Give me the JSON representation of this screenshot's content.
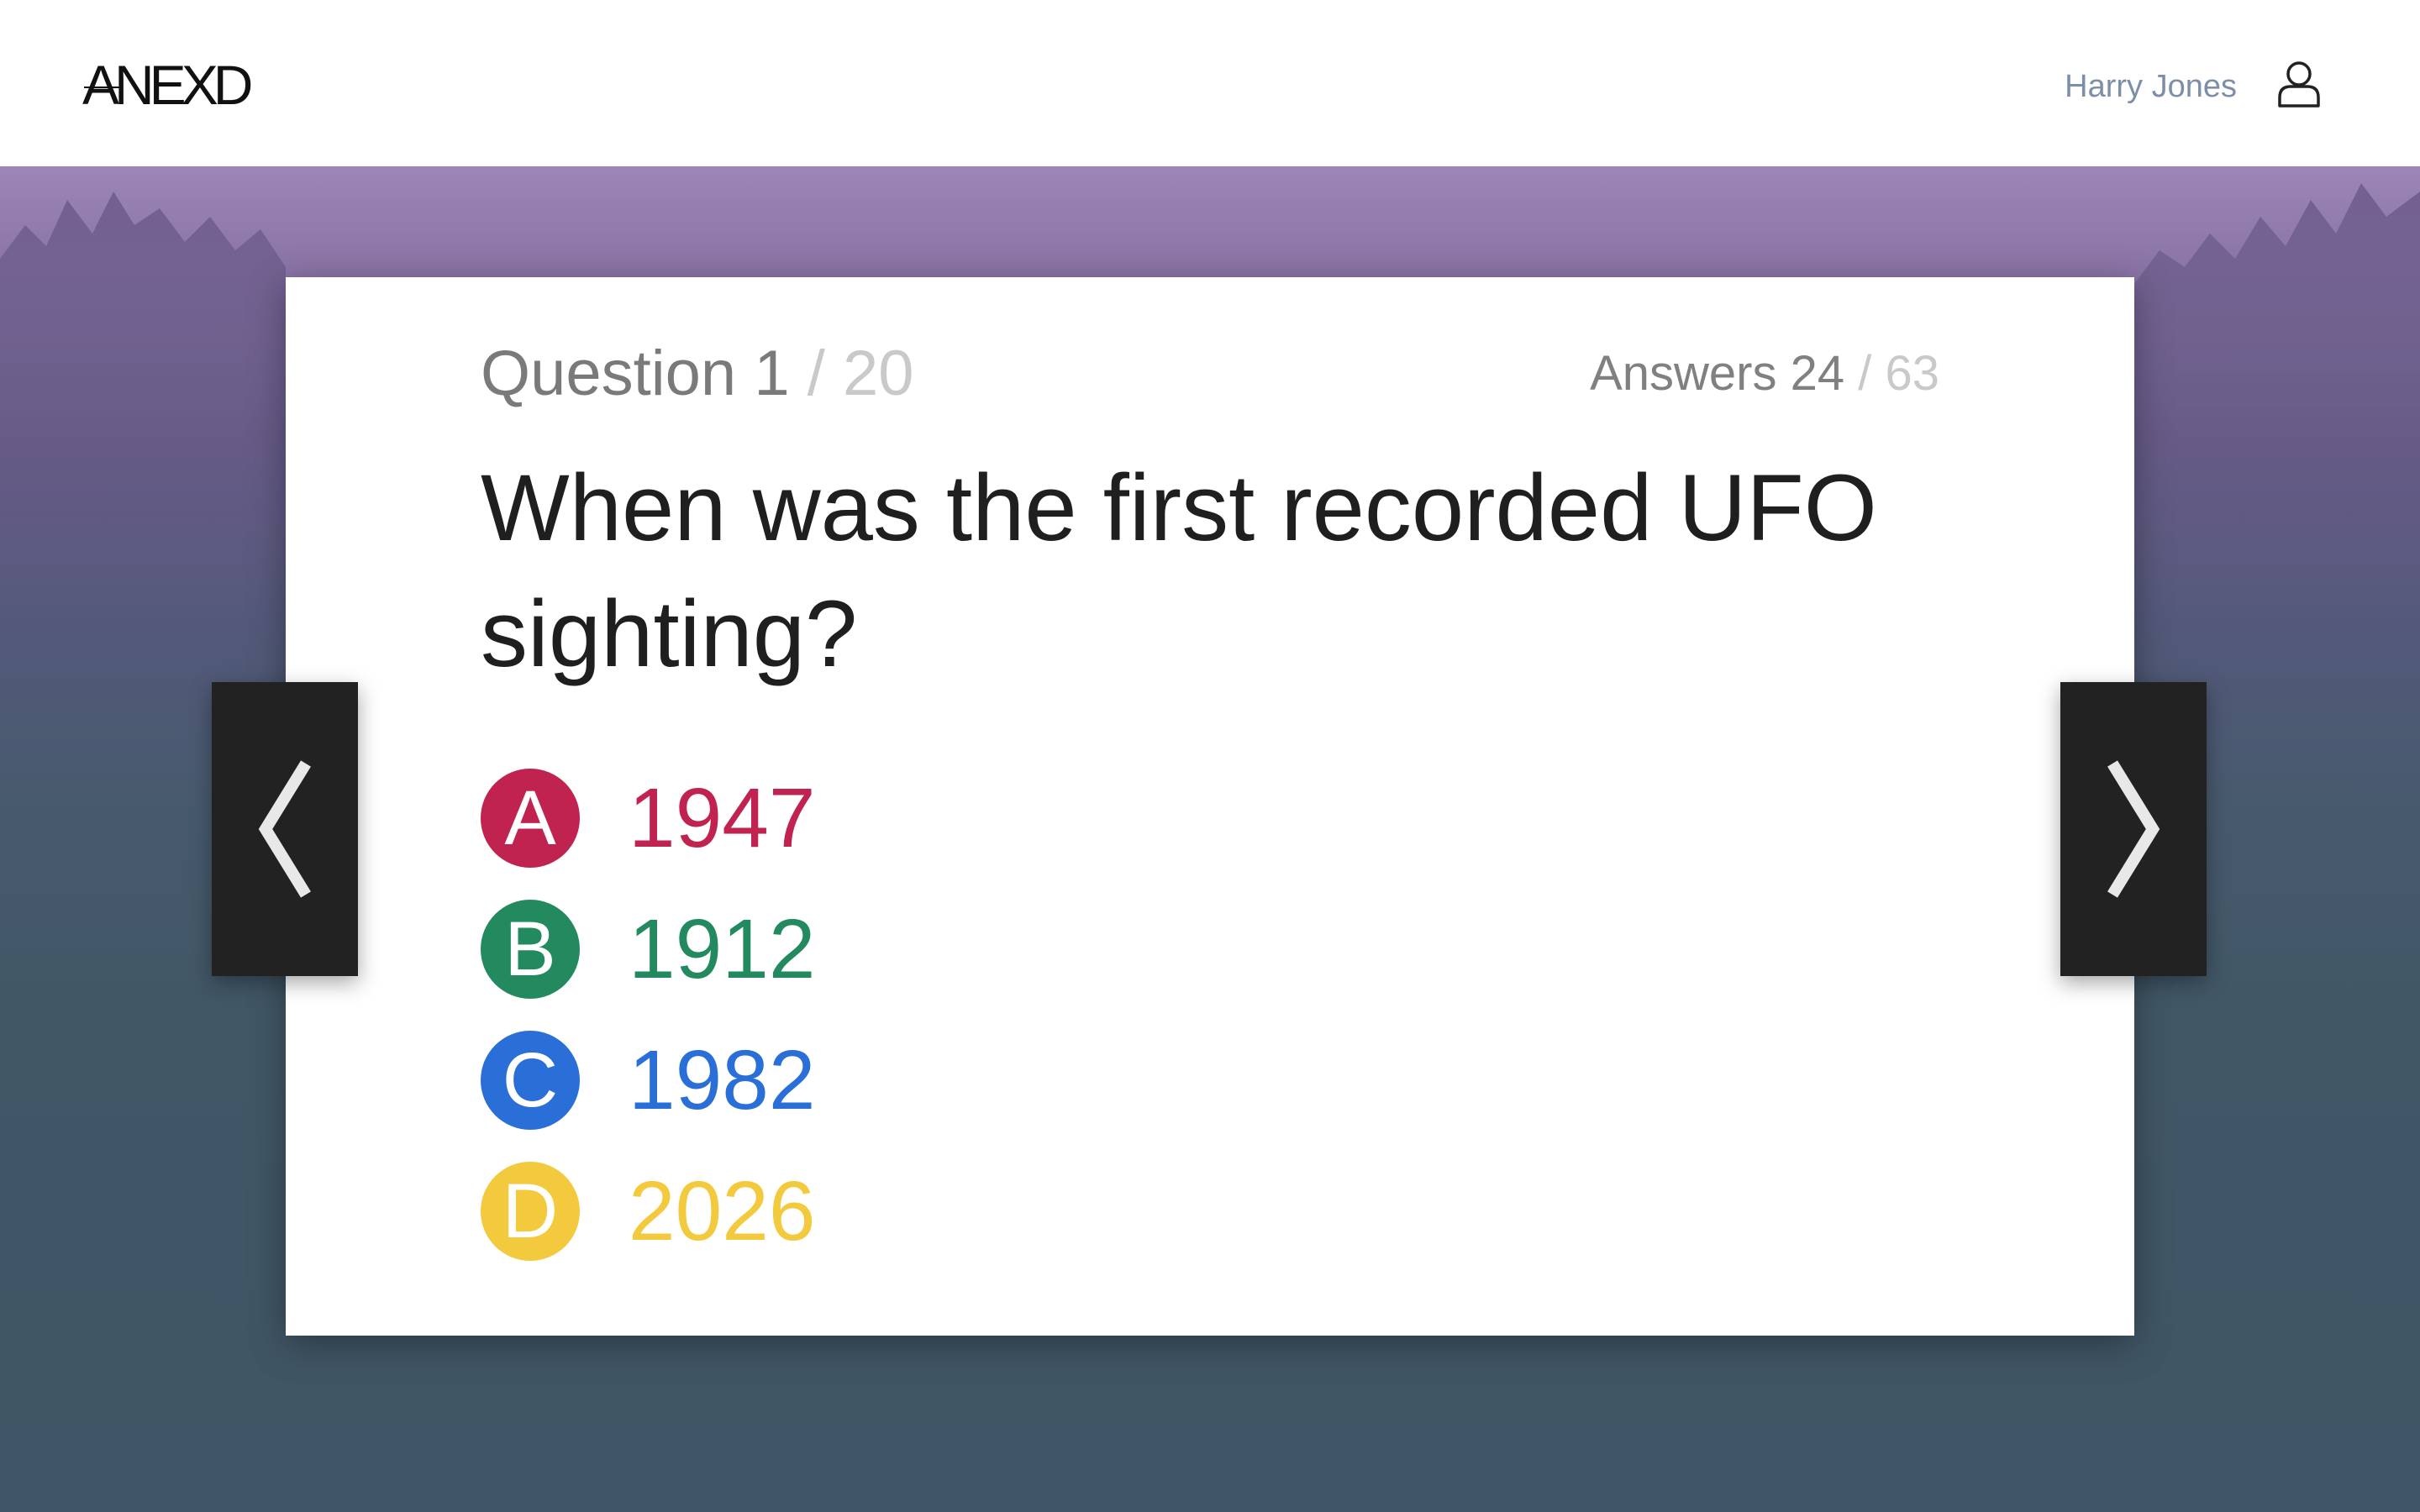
{
  "header": {
    "logo": "ANEXD",
    "user_name": "Harry Jones"
  },
  "quiz": {
    "question_label": "Question",
    "question_current": "1",
    "question_total": "/ 20",
    "answers_label": "Answers",
    "answers_current": "24",
    "answers_total": "/ 63",
    "question_text": "When was the first recorded UFO sighting?",
    "options": [
      {
        "letter": "A",
        "text": "1947",
        "color": "#c0234f"
      },
      {
        "letter": "B",
        "text": "1912",
        "color": "#228a5e"
      },
      {
        "letter": "C",
        "text": "1982",
        "color": "#2a6fd8"
      },
      {
        "letter": "D",
        "text": "2026",
        "color": "#f3c93d"
      }
    ]
  },
  "nav": {
    "prev_icon": "chevron-left-icon",
    "next_icon": "chevron-right-icon"
  }
}
